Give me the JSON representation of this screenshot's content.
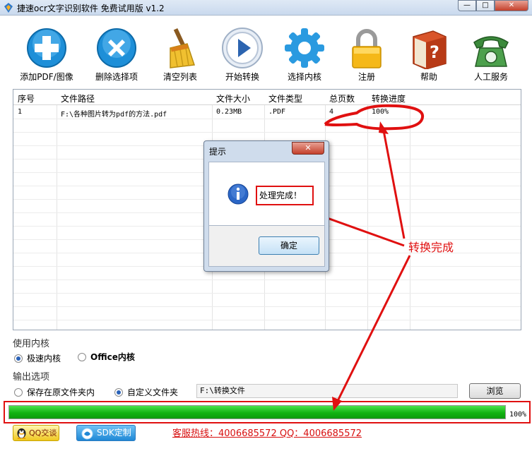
{
  "window": {
    "title": "捷速ocr文字识别软件 免费试用版 v1.2",
    "minimize": "—",
    "maximize": "□",
    "close": "✕"
  },
  "toolbar": {
    "items": [
      {
        "label": "添加PDF/图像",
        "icon": "add-icon"
      },
      {
        "label": "删除选择项",
        "icon": "delete-icon"
      },
      {
        "label": "清空列表",
        "icon": "broom-icon"
      },
      {
        "label": "开始转换",
        "icon": "play-icon"
      },
      {
        "label": "选择内核",
        "icon": "gear-icon"
      },
      {
        "label": "注册",
        "icon": "lock-icon"
      },
      {
        "label": "帮助",
        "icon": "help-book-icon"
      },
      {
        "label": "人工服务",
        "icon": "phone-icon"
      }
    ]
  },
  "table": {
    "columns": [
      "序号",
      "文件路径",
      "文件大小",
      "文件类型",
      "总页数",
      "转换进度"
    ],
    "rows": [
      [
        "1",
        "F:\\各种图片转为pdf的方法.pdf",
        "0.23MB",
        ".PDF",
        "4",
        "100%"
      ]
    ]
  },
  "dialog": {
    "title": "提示",
    "close": "✕",
    "message": "处理完成！",
    "ok_label": "确定",
    "icon": "info-icon"
  },
  "engine": {
    "label": "使用内核",
    "options": [
      "极速内核",
      "Office内核"
    ],
    "selected": "极速内核"
  },
  "output": {
    "label": "输出选项",
    "options": [
      "保存在原文件夹内",
      "自定义文件夹"
    ],
    "selected": "自定义文件夹",
    "path": "F:\\转换文件",
    "browse_label": "浏览"
  },
  "progress": {
    "value": 100,
    "text": "100%",
    "color": "#12b312"
  },
  "footer": {
    "qq_label": "QQ交谈",
    "sdk_label": "SDK定制",
    "hotline": "客服热线：4006685572 QQ：4006685572"
  },
  "annotation": {
    "text": "转换完成",
    "color": "#e01010"
  }
}
